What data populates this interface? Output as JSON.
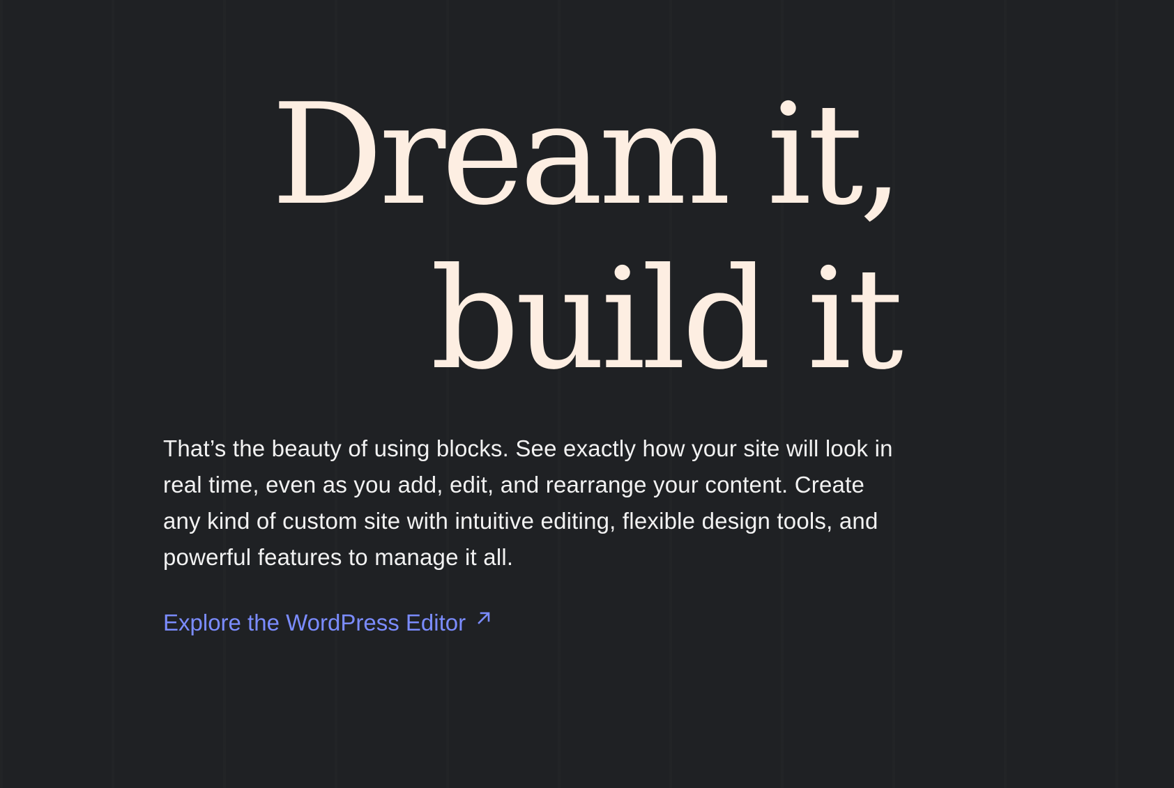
{
  "hero": {
    "headline_line1": "Dream it,",
    "headline_line2": "build it",
    "body": "That’s the beauty of using blocks. See exactly how your site will look in real time, even as you add, edit, and rearrange your content. Create any kind of custom site with intuitive editing, flexible design tools, and powerful features to manage it all.",
    "link_label": "Explore the WordPress Editor",
    "link_icon": "arrow-up-right-icon"
  },
  "colors": {
    "background": "#1f2124",
    "headline": "#fdeee2",
    "body_text": "#f2f2f2",
    "link": "#7b8cff"
  }
}
